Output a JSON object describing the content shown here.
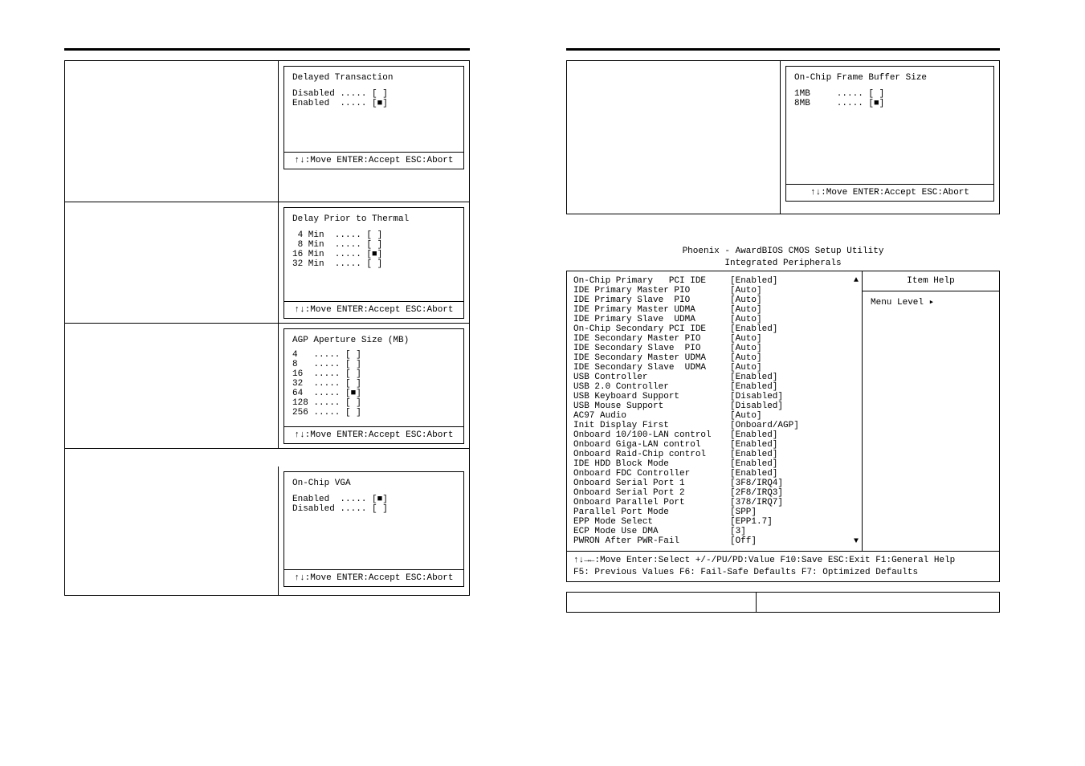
{
  "footer_hint": "↑↓:Move ENTER:Accept ESC:Abort",
  "popups": {
    "delayed": {
      "title": "Delayed Transaction",
      "opts": [
        {
          "label": "Disabled",
          "sel": false
        },
        {
          "label": "Enabled ",
          "sel": true
        }
      ]
    },
    "thermal": {
      "title": "Delay Prior to Thermal",
      "opts": [
        {
          "label": " 4 Min",
          "sel": false
        },
        {
          "label": " 8 Min",
          "sel": false
        },
        {
          "label": "16 Min",
          "sel": true
        },
        {
          "label": "32 Min",
          "sel": false
        }
      ]
    },
    "agp": {
      "title": "AGP Aperture Size (MB)",
      "opts": [
        {
          "label": "4  ",
          "sel": false
        },
        {
          "label": "8  ",
          "sel": false
        },
        {
          "label": "16 ",
          "sel": false
        },
        {
          "label": "32 ",
          "sel": false
        },
        {
          "label": "64 ",
          "sel": true
        },
        {
          "label": "128",
          "sel": false
        },
        {
          "label": "256",
          "sel": false
        }
      ]
    },
    "vga": {
      "title": "On-Chip VGA",
      "opts": [
        {
          "label": "Enabled ",
          "sel": true
        },
        {
          "label": "Disabled",
          "sel": false
        }
      ]
    },
    "fbuf": {
      "title": "On-Chip Frame Buffer Size",
      "opts": [
        {
          "label": "1MB    ",
          "sel": false
        },
        {
          "label": "8MB    ",
          "sel": true
        }
      ]
    }
  },
  "bios": {
    "title1": "Phoenix - AwardBIOS CMOS Setup Utility",
    "title2": "Integrated Peripherals",
    "help_title": "Item Help",
    "help_menu": "Menu Level   ▸",
    "footer1": "↑↓→←:Move  Enter:Select  +/-/PU/PD:Value  F10:Save  ESC:Exit  F1:General Help",
    "footer2": "  F5: Previous Values    F6: Fail-Safe Defaults    F7: Optimized Defaults",
    "items": [
      {
        "label": "On-Chip Primary   PCI IDE",
        "val": "[Enabled]"
      },
      {
        "label": "IDE Primary Master PIO",
        "val": "[Auto]"
      },
      {
        "label": "IDE Primary Slave  PIO",
        "val": "[Auto]"
      },
      {
        "label": "IDE Primary Master UDMA",
        "val": "[Auto]"
      },
      {
        "label": "IDE Primary Slave  UDMA",
        "val": "[Auto]"
      },
      {
        "label": "On-Chip Secondary PCI IDE",
        "val": "[Enabled]"
      },
      {
        "label": "IDE Secondary Master PIO",
        "val": "[Auto]"
      },
      {
        "label": "IDE Secondary Slave  PIO",
        "val": "[Auto]"
      },
      {
        "label": "IDE Secondary Master UDMA",
        "val": "[Auto]"
      },
      {
        "label": "IDE Secondary Slave  UDMA",
        "val": "[Auto]"
      },
      {
        "label": "USB Controller",
        "val": "[Enabled]"
      },
      {
        "label": "USB 2.0 Controller",
        "val": "[Enabled]"
      },
      {
        "label": "USB Keyboard Support",
        "val": "[Disabled]"
      },
      {
        "label": "USB Mouse Support",
        "val": "[Disabled]"
      },
      {
        "label": "AC97 Audio",
        "val": "[Auto]"
      },
      {
        "label": "Init Display First",
        "val": "[Onboard/AGP]"
      },
      {
        "label": "Onboard 10/100-LAN control",
        "val": "[Enabled]"
      },
      {
        "label": "Onboard Giga-LAN control",
        "val": "[Enabled]"
      },
      {
        "label": "Onboard Raid-Chip control",
        "val": "[Enabled]"
      },
      {
        "label": "IDE HDD Block Mode",
        "val": "[Enabled]"
      },
      {
        "label": "Onboard FDC Controller",
        "val": "[Enabled]"
      },
      {
        "label": "Onboard Serial Port 1",
        "val": "[3F8/IRQ4]"
      },
      {
        "label": "Onboard Serial Port 2",
        "val": "[2F8/IRQ3]"
      },
      {
        "label": "Onboard Parallel Port",
        "val": "[378/IRQ7]"
      },
      {
        "label": "Parallel Port Mode",
        "val": "[SPP]"
      },
      {
        "label": "EPP Mode Select",
        "val": "[EPP1.7]"
      },
      {
        "label": "ECP Mode Use DMA",
        "val": "[3]"
      },
      {
        "label": "PWRON After PWR-Fail",
        "val": "[Off]"
      }
    ]
  }
}
